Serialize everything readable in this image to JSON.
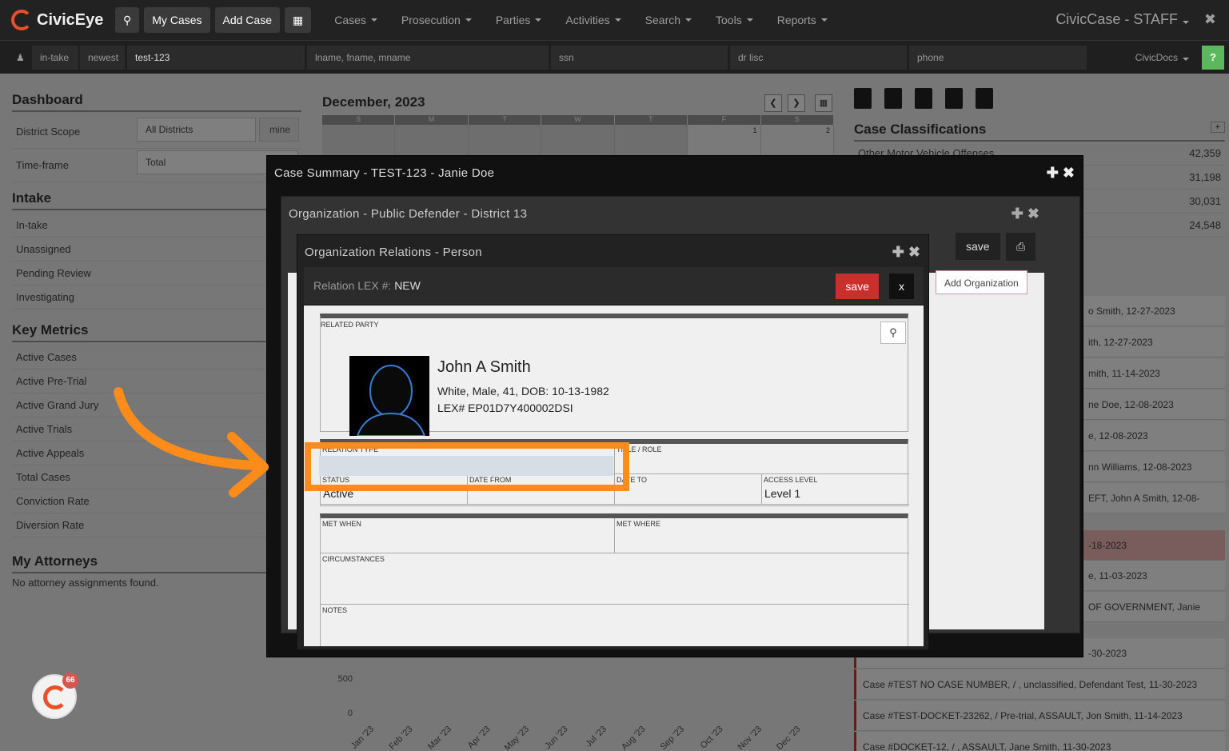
{
  "nav": {
    "brand": "CivicEye",
    "my_cases": "My Cases",
    "add_case": "Add Case",
    "menus": [
      "Cases",
      "Prosecution",
      "Parties",
      "Activities",
      "Search",
      "Tools",
      "Reports"
    ],
    "app_name": "CivicCase - STAFF"
  },
  "searchbar": {
    "intake": "in-take",
    "newest": "newest",
    "case_value": "test-123",
    "name_ph": "lname, fname, mname",
    "ssn_ph": "ssn",
    "dl_ph": "dr lisc",
    "phone_ph": "phone",
    "civicdocs": "CivicDocs",
    "help": "?"
  },
  "dashboard": {
    "title": "Dashboard",
    "district_scope_label": "District Scope",
    "district_scope_value": "All Districts",
    "mine": "mine",
    "timeframe_label": "Time-frame",
    "timeframe_value": "Total"
  },
  "intake": {
    "title": "Intake",
    "items": [
      "In-take",
      "Unassigned",
      "Pending Review",
      "Investigating"
    ]
  },
  "metrics": {
    "title": "Key Metrics",
    "items": [
      "Active Cases",
      "Active Pre-Trial",
      "Active Grand Jury",
      "Active Trials",
      "Active Appeals",
      "Total Cases",
      "Conviction Rate",
      "Diversion Rate"
    ]
  },
  "attorneys": {
    "title": "My Attorneys",
    "empty": "No attorney assignments found."
  },
  "calendar": {
    "title": "December, 2023",
    "days": [
      "S",
      "M",
      "T",
      "W",
      "T",
      "F",
      "S"
    ],
    "dates": [
      "",
      "",
      "",
      "",
      "",
      "1",
      "2"
    ]
  },
  "classifications": {
    "title": "Case Classifications",
    "add": "+",
    "rows": [
      {
        "label": "Other Motor Vehicle Offenses",
        "count": "42,359"
      },
      {
        "label": "",
        "count": "31,198"
      },
      {
        "label": "",
        "count": "30,031"
      },
      {
        "label": "",
        "count": "24,548"
      }
    ]
  },
  "recent_cases": [
    "o Smith, 12-27-2023",
    "ith, 12-27-2023",
    "mith, 11-14-2023",
    "ne Doe, 12-08-2023",
    "e, 12-08-2023",
    "nn Williams, 12-08-2023",
    "EFT, John A Smith, 12-08-",
    "-18-2023",
    "e, 11-03-2023",
    "OF GOVERNMENT, Janie",
    "-30-2023",
    "Case #TEST NO CASE NUMBER, / , unclassified, Defendant Test, 11-30-2023",
    "Case #TEST-DOCKET-23262, / Pre-trial, ASSAULT, Jon Smith, 11-14-2023",
    "Case #DOCKET-12, / , ASSAULT, Jane Smith, 11-30-2023"
  ],
  "chart_data": {
    "type": "bar",
    "categories": [
      "Jan '23",
      "Feb '23",
      "Mar '23",
      "Apr '23",
      "May '23",
      "Jun '23",
      "Jul '23",
      "Aug '23",
      "Sep '23",
      "Oct '23",
      "Nov '23",
      "Dec '23"
    ],
    "y_ticks": [
      "500",
      "0"
    ]
  },
  "dialog1": {
    "title": "Case Summary - TEST-123 - Janie Doe"
  },
  "dialog2": {
    "title": "Organization - Public Defender - District 13",
    "save": "save",
    "add_org": "Add Organization"
  },
  "dialog3": {
    "title": "Organization Relations - Person",
    "relation_lex_label": "Relation LEX #:",
    "relation_lex_value": "NEW",
    "save": "save",
    "close": "x",
    "related_party_label": "RELATED PARTY",
    "person_name": "John A Smith",
    "person_desc": "White, Male, 41, DOB: 10-13-1982",
    "person_lex": "LEX# EP01D7Y400002DSI",
    "relation_type_label": "RELATION TYPE",
    "title_role_label": "TITLE / ROLE",
    "status_label": "STATUS",
    "status_value": "Active",
    "date_from_label": "DATE FROM",
    "date_to_label": "DATE TO",
    "access_level_label": "ACCESS LEVEL",
    "access_level_value": "Level 1",
    "met_when_label": "MET WHEN",
    "met_where_label": "MET WHERE",
    "circumstances_label": "CIRCUMSTANCES",
    "notes_label": "NOTES"
  },
  "chat_badge": "66",
  "colors": {
    "accent": "#ff8c1a",
    "brand": "#e8502a",
    "save": "#c9302c"
  }
}
